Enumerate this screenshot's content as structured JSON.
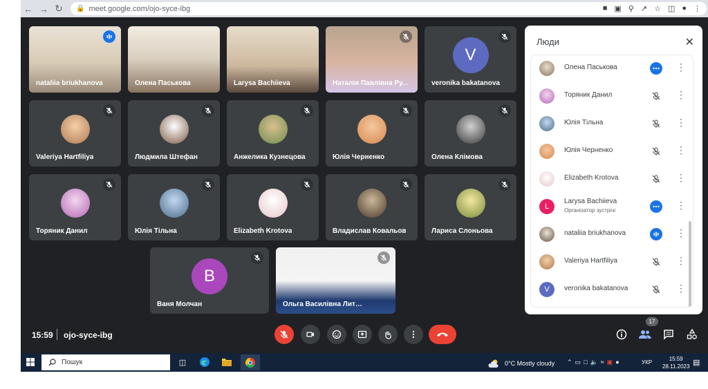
{
  "browser": {
    "url": "meet.google.com/ojo-syce-ibg"
  },
  "tiles": [
    {
      "name": "nataliia briukhanova",
      "mic": "talking",
      "active": true
    },
    {
      "name": "Олена Паськова",
      "mic": "none"
    },
    {
      "name": "Larysa Bachiieva",
      "mic": "none"
    },
    {
      "name": "Наталія Павлівна Ру...",
      "mic": "off"
    },
    {
      "name": "veronika bakatanova",
      "mic": "off",
      "letter": "V",
      "color": "#5c6bc0"
    },
    {
      "name": "Valeriya Hartfiliya",
      "mic": "off"
    },
    {
      "name": "Людмила Штефан",
      "mic": "off"
    },
    {
      "name": "Анжелика Кузнецова",
      "mic": "off"
    },
    {
      "name": "Юлія Черненко",
      "mic": "off"
    },
    {
      "name": "Олена Клімова",
      "mic": "off"
    },
    {
      "name": "Торяник Данил",
      "mic": "off"
    },
    {
      "name": "Юлія Тільна",
      "mic": "off"
    },
    {
      "name": "Elizabeth Krotova",
      "mic": "off"
    },
    {
      "name": "Владислав Ковальов",
      "mic": "off"
    },
    {
      "name": "Лариса Слоньова",
      "mic": "off"
    },
    {
      "name": "Ваня Молчан",
      "mic": "off",
      "letter": "B",
      "color": "#ab47bc"
    },
    {
      "name": "Ольга Василівна Литвин",
      "mic": "off"
    }
  ],
  "meeting": {
    "time": "15:59",
    "code": "ojo-syce-ibg",
    "participants_count": "17"
  },
  "panel": {
    "title": "Люди",
    "participants": [
      {
        "name": "Олена Паськова",
        "status": "more"
      },
      {
        "name": "Торяник Данил",
        "status": "muted"
      },
      {
        "name": "Юлія Тільна",
        "status": "muted"
      },
      {
        "name": "Юлія Черненко",
        "status": "muted"
      },
      {
        "name": "Elizabeth Krotova",
        "status": "muted"
      },
      {
        "name": "Larysa Bachiieva",
        "role": "Організатор зустрічі",
        "status": "more",
        "letter": "L",
        "color": "#e91e63"
      },
      {
        "name": "nataliia briukhanova",
        "status": "talking"
      },
      {
        "name": "Valeriya Hartfiliya",
        "status": "muted"
      },
      {
        "name": "veronika bakatanova",
        "status": "muted",
        "letter": "V",
        "color": "#5c6bc0"
      }
    ]
  },
  "taskbar": {
    "search_placeholder": "Пошук",
    "weather": "0°C  Mostly cloudy",
    "lang": "УКР",
    "time": "15:59",
    "date": "28.11.2023"
  },
  "colors": {
    "meet_bg": "#202124",
    "tile_bg": "#3c4043",
    "hangup": "#ea4335",
    "accent": "#1a73e8"
  }
}
